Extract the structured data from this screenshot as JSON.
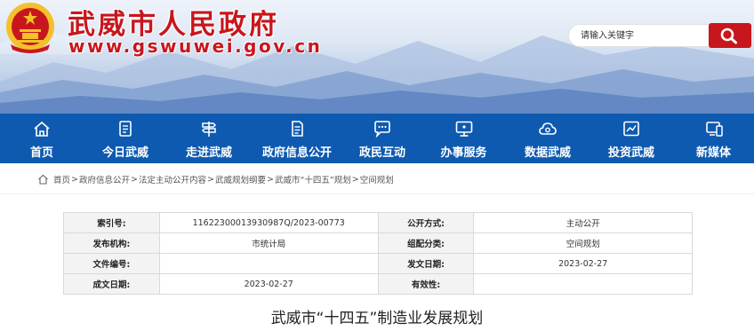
{
  "header": {
    "site_title": "武威市人民政府",
    "site_url": "www.gswuwei.gov.cn",
    "emblem_icon": "national-emblem-icon",
    "search": {
      "placeholder": "请输入关键字",
      "button_icon": "search-icon"
    }
  },
  "colors": {
    "brand_red": "#c8161d",
    "nav_blue": "#0e5ab0"
  },
  "nav": {
    "items": [
      {
        "label": "首页",
        "icon": "home-icon"
      },
      {
        "label": "今日武威",
        "icon": "news-icon"
      },
      {
        "label": "走进武威",
        "icon": "signpost-icon"
      },
      {
        "label": "政府信息公开",
        "icon": "document-icon"
      },
      {
        "label": "政民互动",
        "icon": "chat-icon"
      },
      {
        "label": "办事服务",
        "icon": "monitor-icon"
      },
      {
        "label": "数据武威",
        "icon": "cloud-data-icon"
      },
      {
        "label": "投资武威",
        "icon": "chart-icon"
      },
      {
        "label": "新媒体",
        "icon": "mobile-icon"
      }
    ]
  },
  "breadcrumb": [
    "首页",
    "政府信息公开",
    "法定主动公开内容",
    "武威规划纲要",
    "武威市“十四五”规划",
    "空间规划"
  ],
  "breadcrumb_separator": ">",
  "info_table": {
    "rows": [
      [
        {
          "label": "索引号:",
          "value": "11622300013930987Q/2023-00773"
        },
        {
          "label": "公开方式:",
          "value": "主动公开"
        }
      ],
      [
        {
          "label": "发布机构:",
          "value": "市统计局"
        },
        {
          "label": "组配分类:",
          "value": "空间规划"
        }
      ],
      [
        {
          "label": "文件编号:",
          "value": ""
        },
        {
          "label": "发文日期:",
          "value": "2023-02-27"
        }
      ],
      [
        {
          "label": "成文日期:",
          "value": "2023-02-27"
        },
        {
          "label": "有效性:",
          "value": ""
        }
      ]
    ]
  },
  "article": {
    "title": "武威市“十四五”制造业发展规划"
  }
}
